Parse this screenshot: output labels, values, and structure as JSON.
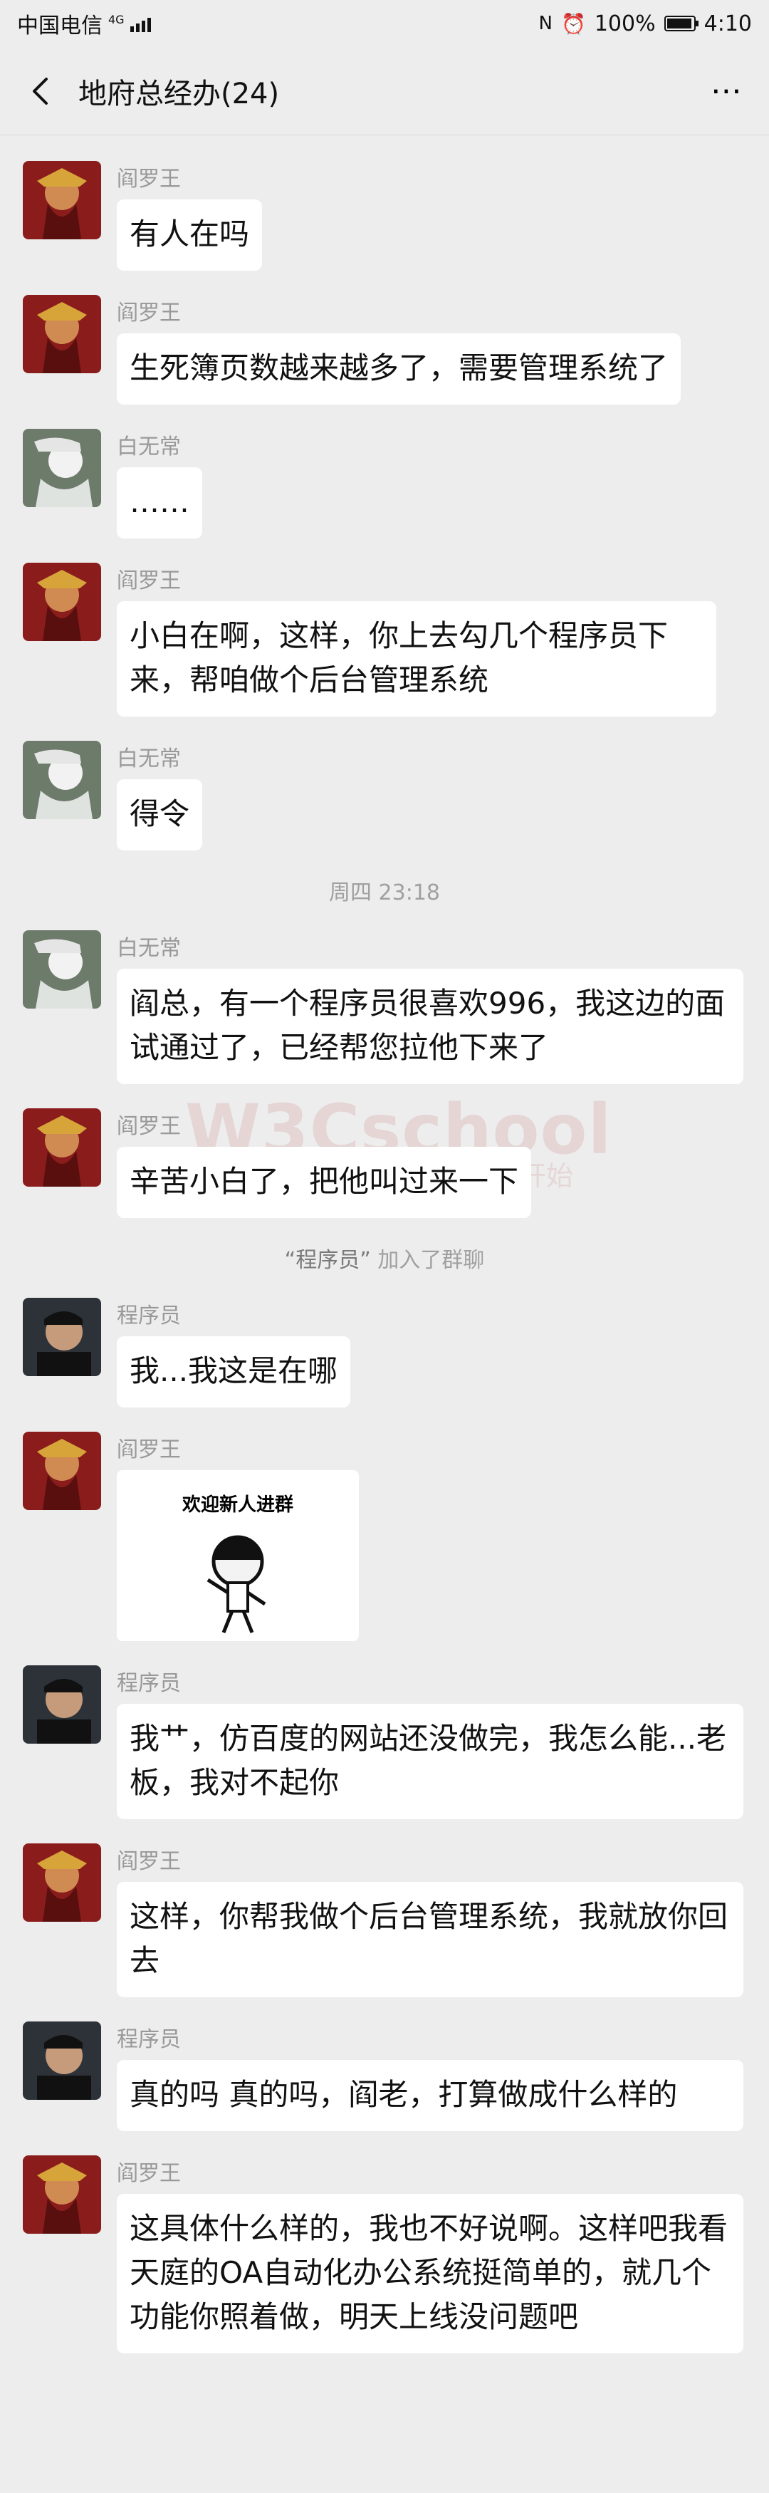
{
  "status": {
    "carrier": "中国电信",
    "network": "4G",
    "battery": "100%",
    "time": "4:10"
  },
  "header": {
    "title": "地府总经办(24)"
  },
  "messages": [
    {
      "name": "阎罗王",
      "text": "有人在吗"
    },
    {
      "name": "阎罗王",
      "text": "生死簿页数越来越多了，需要管理系统了"
    },
    {
      "name": "白无常",
      "text": "……"
    },
    {
      "name": "阎罗王",
      "text": "小白在啊，这样，你上去勾几个程序员下来，帮咱做个后台管理系统"
    },
    {
      "name": "白无常",
      "text": "得令"
    },
    {
      "name": "白无常",
      "text": "阎总，有一个程序员很喜欢996，我这边的面试通过了，已经帮您拉他下来了"
    },
    {
      "name": "阎罗王",
      "text": "辛苦小白了，把他叫过来一下"
    },
    {
      "name": "程序员",
      "text": "我...我这是在哪"
    },
    {
      "name": "阎罗王",
      "sticker_caption": "欢迎新人进群"
    },
    {
      "name": "程序员",
      "text": "我艹，仿百度的网站还没做完，我怎么能...老板，我对不起你"
    },
    {
      "name": "阎罗王",
      "text": "这样，你帮我做个后台管理系统，我就放你回去"
    },
    {
      "name": "程序员",
      "text": "真的吗 真的吗，阎老，打算做成什么样的"
    },
    {
      "name": "阎罗王",
      "text": "这具体什么样的，我也不好说啊。这样吧我看天庭的OA自动化办公系统挺简单的，就几个功能你照着做，明天上线没问题吧"
    }
  ],
  "timestamp": "周四 23:18",
  "system_join": {
    "name": "“程序员”",
    "suffix": "加入了群聊"
  },
  "watermark": {
    "brand": "W3Cschool",
    "subtitle": "学编程，从w3cschool.cn开始"
  },
  "colors": {
    "bg": "#ededed",
    "bubble": "#ffffff",
    "meta": "#999999"
  }
}
